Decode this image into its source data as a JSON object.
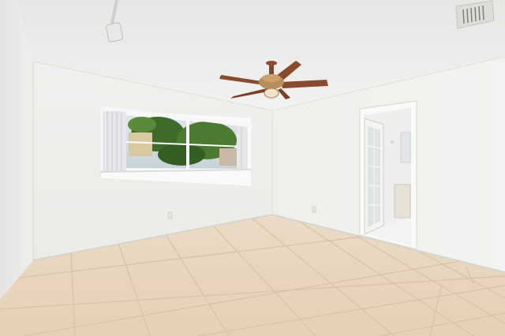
{
  "scene": {
    "description_free": true,
    "colors": {
      "ceiling": "#ececeb",
      "wall_left": "#eeeeec",
      "wall_back": "#f1f1ef",
      "wall_right": "#eeeeeb",
      "floor": "#e8d5bf",
      "grout": "#d9c3aa",
      "fan_blade": "#8a4a2e",
      "fan_body": "#b98d5a",
      "window_trim": "#fafafa",
      "tree_green": "#3f6b2a",
      "door_white": "#f4f4f2"
    },
    "icons": {
      "ceiling_fan": "ceiling-fan-icon",
      "track_light": "track-light-icon",
      "vent": "air-vent-icon"
    }
  }
}
